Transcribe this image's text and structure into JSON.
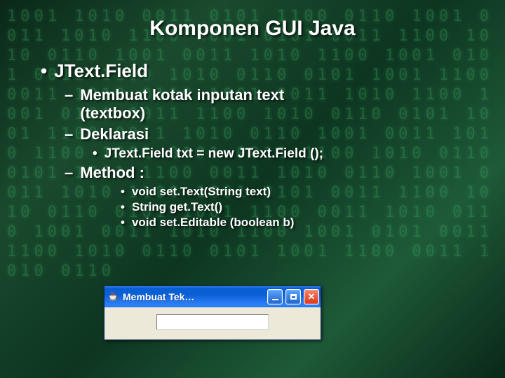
{
  "title": "Komponen GUI Java",
  "l1": "JText.Field",
  "l2a_line1": "Membuat kotak inputan text",
  "l2a_line2": "(textbox)",
  "l2b": "Deklarasi",
  "l3a": "JText.Field txt = new JText.Field ();",
  "l2c": "Method :",
  "l4a": "void set.Text(String text)",
  "l4b": "String get.Text()",
  "l4c": "void set.Editable (boolean b)",
  "dialog": {
    "title": "Membuat Tek…",
    "textbox_value": ""
  },
  "bg_matrix": "1001 1010 0011 0101 1100 0110 1001 0011 1010 1100 1001 0101 0011 1100 1010 0110 1001 0011 1010 1100 1001 0101 0011 1100 1010 0110 0101 1001 1100 0011 1010 0110 1001 0011 1010 1100 1001 0101 0011 1100 1010 0110 0101 1001 1100 0011 1010 0110 1001 0011 1010 1100 1001 0101 0011 1100 1010 0110 0101 1001 1100 0011 1010 0110 1001 0011 1010 1100 1001 0101 0011 1100 1010 0110 0101 1001 1100 0011 1010 0110 1001 0011 1010 1100 1001 0101 0011 1100 1010 0110 0101 1001 1100 0011 1010 0110"
}
